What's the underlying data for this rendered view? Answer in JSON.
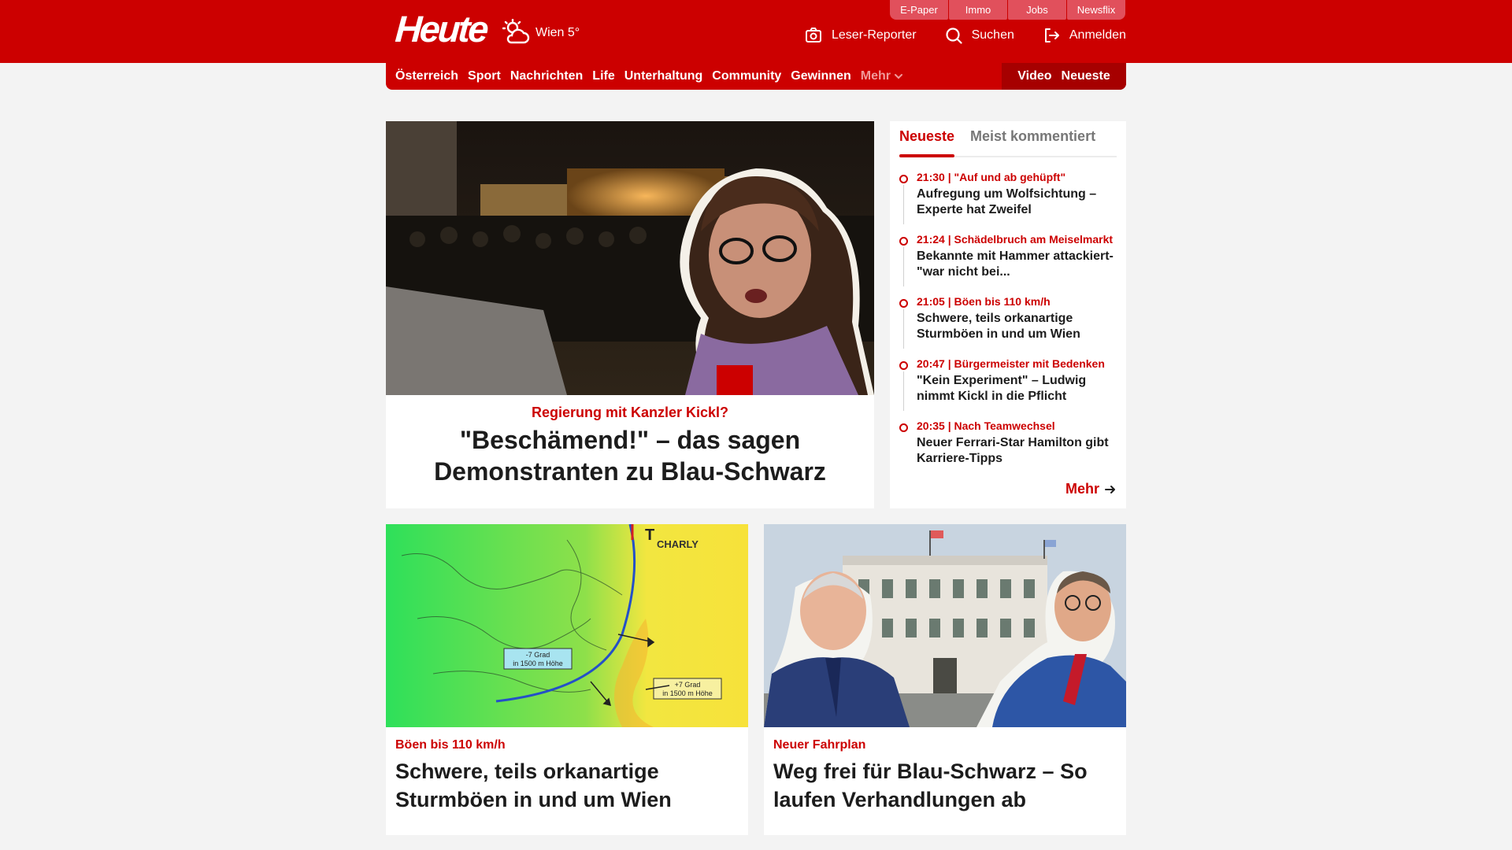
{
  "header": {
    "logo": "Heute",
    "weather": {
      "icon": "cloud-sun-icon",
      "text": "Wien 5°"
    },
    "service_links": [
      "E-Paper",
      "Immo",
      "Jobs",
      "Newsflix"
    ],
    "actions": [
      {
        "label": "Leser-Reporter",
        "icon": "camera-icon"
      },
      {
        "label": "Suchen",
        "icon": "search-icon"
      },
      {
        "label": "Anmelden",
        "icon": "login-icon"
      }
    ],
    "brand_color": "#cc0000"
  },
  "nav": {
    "items": [
      "Österreich",
      "Sport",
      "Nachrichten",
      "Life",
      "Unterhaltung",
      "Community",
      "Gewinnen"
    ],
    "more": "Mehr",
    "right": [
      "Video",
      "Neueste"
    ]
  },
  "hero": {
    "kicker": "Regierung mit Kanzler Kickl?",
    "title": "\"Beschämend!\" – das sagen Demonstranten zu Blau-Schwarz"
  },
  "sidebar": {
    "tabs": [
      "Neueste",
      "Meist kommentiert"
    ],
    "items": [
      {
        "meta": "21:30 | \"Auf und ab gehüpft\"",
        "title": "Aufregung um Wolfsichtung – Experte hat Zweifel"
      },
      {
        "meta": "21:24 | Schädelbruch am Meiselmarkt",
        "title": "Bekannte mit Hammer attackiert- \"war nicht bei..."
      },
      {
        "meta": "21:05 | Böen bis 110 km/h",
        "title": "Schwere, teils orkanartige Sturmböen in und um Wien"
      },
      {
        "meta": "20:47 | Bürgermeister mit Bedenken",
        "title": "\"Kein Experiment\" – Ludwig nimmt Kickl in die Pflicht"
      },
      {
        "meta": "20:35 | Nach Teamwechsel",
        "title": "Neuer Ferrari-Star Hamilton gibt Karriere-Tipps"
      }
    ],
    "more": "Mehr"
  },
  "cards": [
    {
      "kicker": "Böen bis 110 km/h",
      "title": "Schwere, teils orkanartige Sturmböen in und um Wien",
      "map": {
        "label_storm": "CHARLY",
        "label_low": "T",
        "label_cold": [
          "-7 Grad",
          "in 1500 m Höhe"
        ],
        "label_warm": [
          "+7 Grad",
          "in 1500 m Höhe"
        ]
      }
    },
    {
      "kicker": "Neuer Fahrplan",
      "title": "Weg frei für Blau-Schwarz – So laufen Verhandlungen ab"
    }
  ]
}
